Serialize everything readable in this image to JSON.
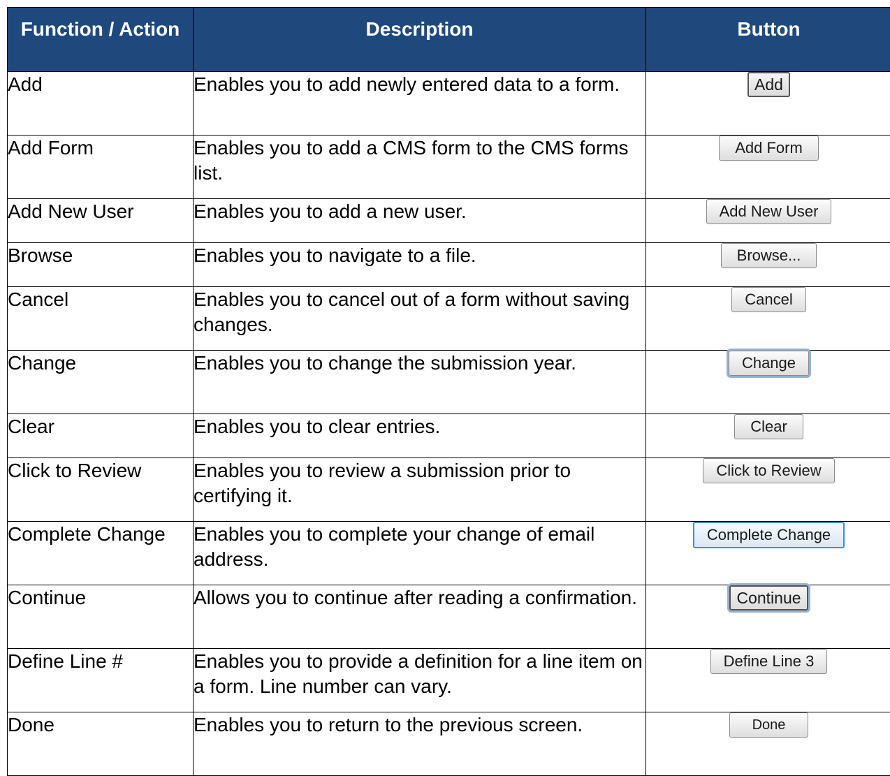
{
  "headers": {
    "function": "Function / Action",
    "description": "Description",
    "button": "Button"
  },
  "rows": [
    {
      "function": "Add",
      "description": "Enables you to add newly entered data to a form.",
      "button": "Add"
    },
    {
      "function": "Add Form",
      "description": "Enables you to add a CMS form to the CMS forms list.",
      "button": "Add Form"
    },
    {
      "function": "Add New User",
      "description": "Enables you to add a new user.",
      "button": "Add New User"
    },
    {
      "function": "Browse",
      "description": "Enables you to navigate to a file.",
      "button": "Browse..."
    },
    {
      "function": "Cancel",
      "description": "Enables you to cancel out of a form without saving changes.",
      "button": "Cancel"
    },
    {
      "function": "Change",
      "description": "Enables you to change the submission year.",
      "button": "Change"
    },
    {
      "function": "Clear",
      "description": "Enables you to clear entries.",
      "button": "Clear"
    },
    {
      "function": "Click to Review",
      "description": "Enables you to review a submission prior to certifying it.",
      "button": "Click to Review"
    },
    {
      "function": "Complete Change",
      "description": "Enables you to complete your change of email address.",
      "button": "Complete Change"
    },
    {
      "function": "Continue",
      "description": "Allows you to continue after reading a confirmation.",
      "button": "Continue"
    },
    {
      "function": "Define Line #",
      "description": "Enables you to provide a definition for a line item on a form.  Line number can vary.",
      "button": "Define Line 3"
    },
    {
      "function": "Done",
      "description": "Enables you to return to the previous screen.",
      "button": "Done"
    }
  ]
}
